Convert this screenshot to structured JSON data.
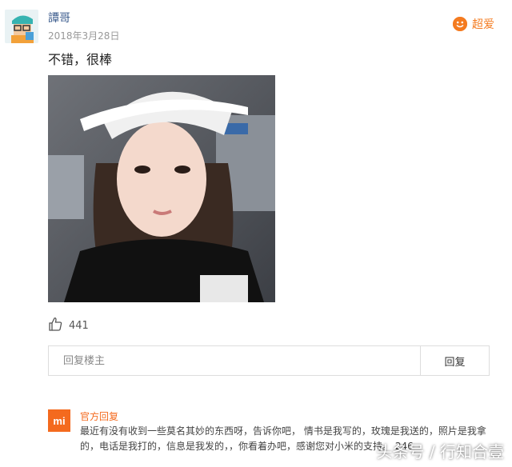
{
  "comment": {
    "username": "譚哥",
    "date": "2018年3月28日",
    "rating_label": "超爱",
    "text": "不错，很棒",
    "likes": "441"
  },
  "reply": {
    "placeholder": "回复楼主",
    "button_label": "回复"
  },
  "official_reply": {
    "logo_text": "mi",
    "label": "官方回复",
    "text": "最近有没有收到一些莫名其妙的东西呀，告诉你吧， 情书是我写的，玫瑰是我送的，照片是我拿的，电话是我打的，信息是我发的，，你看着办吧，感谢您对小米的支持。 246"
  },
  "watermark": "头条号 / 行知合壹",
  "colors": {
    "accent": "#f46a1e",
    "username": "#3a5b8c"
  }
}
